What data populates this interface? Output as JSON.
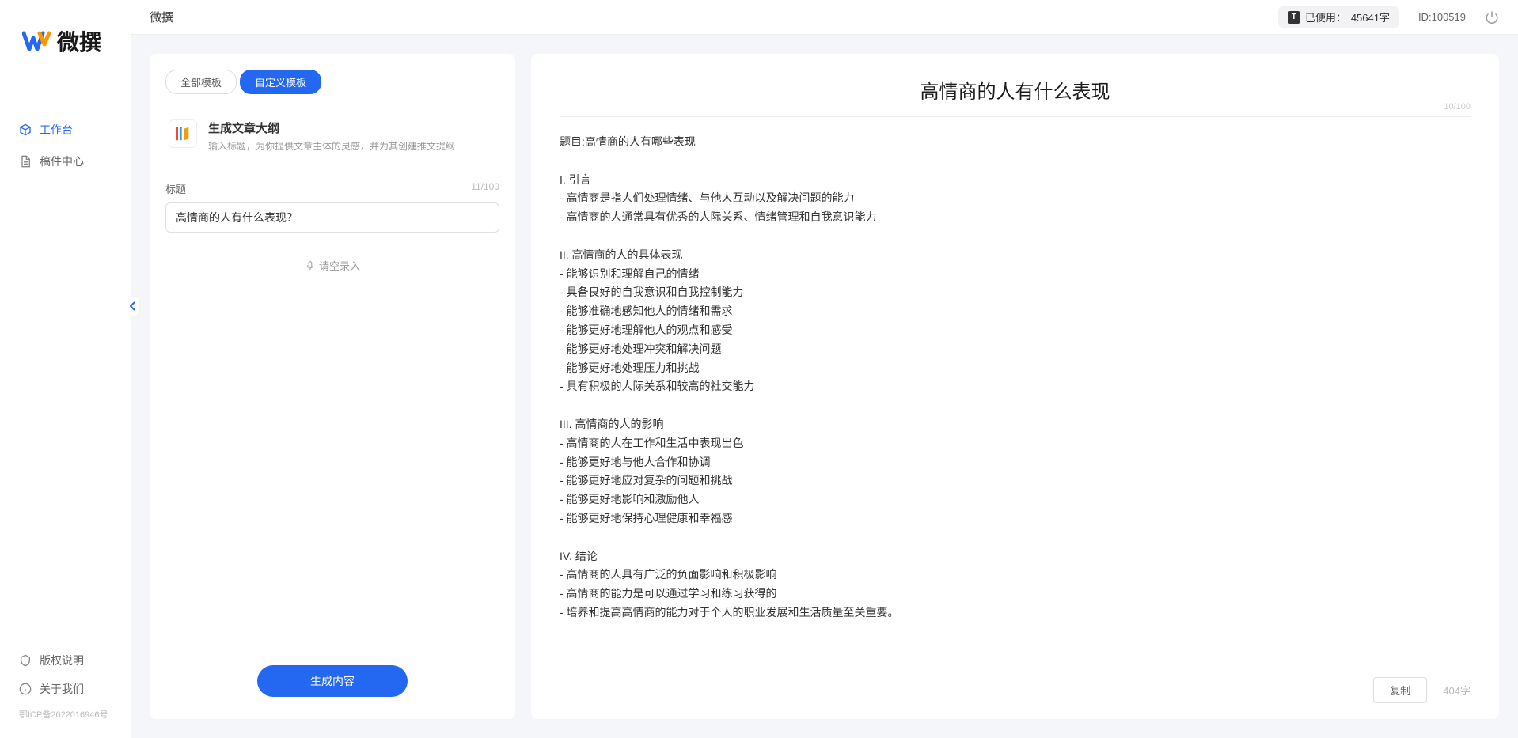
{
  "app": {
    "name": "微撰",
    "logo_text": "微撰"
  },
  "sidebar": {
    "nav": [
      {
        "label": "工作台",
        "icon": "cube"
      },
      {
        "label": "稿件中心",
        "icon": "document"
      }
    ],
    "footer": [
      {
        "label": "版权说明",
        "icon": "shield"
      },
      {
        "label": "关于我们",
        "icon": "info"
      }
    ],
    "icp": "鄂ICP备2022016946号"
  },
  "topbar": {
    "title": "微撰",
    "usage_label": "已使用：",
    "usage_value": "45641字",
    "id_label": "ID:",
    "id_value": "100519"
  },
  "left_panel": {
    "tabs": [
      "全部模板",
      "自定义模板"
    ],
    "template": {
      "title": "生成文章大纲",
      "desc": "输入标题，为你提供文章主体的灵感，并为其创建推文提纲"
    },
    "input": {
      "label": "标题",
      "counter": "11/100",
      "value": "高情商的人有什么表现？"
    },
    "voice_input": "请空录入",
    "generate_btn": "生成内容"
  },
  "right_panel": {
    "title": "高情商的人有什么表现",
    "title_counter": "10/100",
    "body": "题目:高情商的人有哪些表现\n\nI. 引言\n- 高情商是指人们处理情绪、与他人互动以及解决问题的能力\n- 高情商的人通常具有优秀的人际关系、情绪管理和自我意识能力\n\nII. 高情商的人的具体表现\n- 能够识别和理解自己的情绪\n- 具备良好的自我意识和自我控制能力\n- 能够准确地感知他人的情绪和需求\n- 能够更好地理解他人的观点和感受\n- 能够更好地处理冲突和解决问题\n- 能够更好地处理压力和挑战\n- 具有积极的人际关系和较高的社交能力\n\nIII. 高情商的人的影响\n- 高情商的人在工作和生活中表现出色\n- 能够更好地与他人合作和协调\n- 能够更好地应对复杂的问题和挑战\n- 能够更好地影响和激励他人\n- 能够更好地保持心理健康和幸福感\n\nIV. 结论\n- 高情商的人具有广泛的负面影响和积极影响\n- 高情商的能力是可以通过学习和练习获得的\n- 培养和提高高情商的能力对于个人的职业发展和生活质量至关重要。",
    "copy_btn": "复制",
    "word_count": "404字"
  }
}
